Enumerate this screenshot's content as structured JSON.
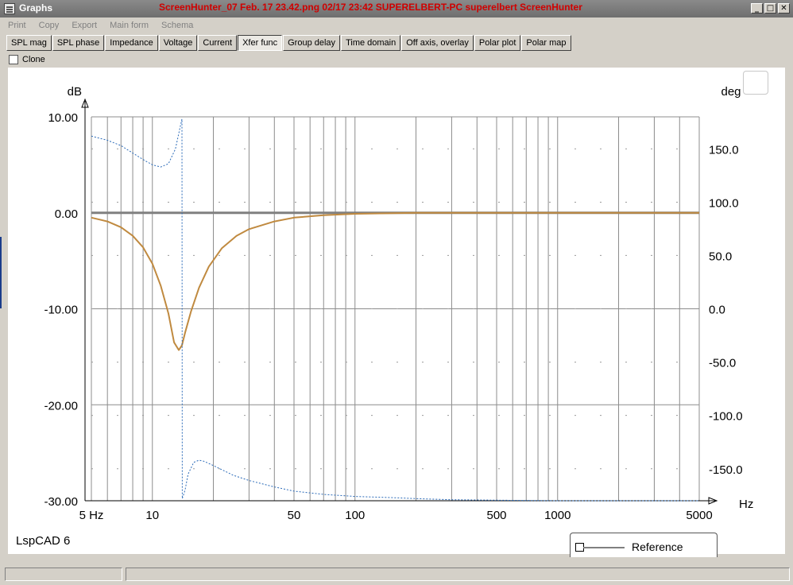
{
  "window": {
    "title": "Graphs",
    "caption": "ScreenHunter_07 Feb. 17 23.42.png  02/17  23:42  SUPERELBERT-PC  superelbert  ScreenHunter"
  },
  "window_buttons": [
    "_",
    "□",
    "✕"
  ],
  "menu": [
    "Print",
    "Copy",
    "Export",
    "Main form",
    "Schema"
  ],
  "tabs": [
    "SPL mag",
    "SPL phase",
    "Impedance",
    "Voltage",
    "Current",
    "Xfer func",
    "Group delay",
    "Time domain",
    "Off axis, overlay",
    "Polar plot",
    "Polar map"
  ],
  "active_tab": "Xfer func",
  "clone_label": "Clone",
  "app_label": "LspCAD 6",
  "legend": {
    "label": "Reference"
  },
  "colors": {
    "magnitude": "#c08a40",
    "phase": "#2a6ab8",
    "reference": "#808080",
    "caption": "#d00000"
  },
  "chart_data": {
    "type": "line",
    "xscale": "log",
    "xlim": [
      5,
      5000
    ],
    "xlabel": "Hz",
    "ylabel_left": "dB",
    "ylabel_right": "deg",
    "ylim_left": [
      -30,
      10
    ],
    "ylim_right": [
      -180,
      180
    ],
    "xticks": [
      {
        "value": 5,
        "label": "5 Hz"
      },
      {
        "value": 10,
        "label": "10"
      },
      {
        "value": 50,
        "label": "50"
      },
      {
        "value": 100,
        "label": "100"
      },
      {
        "value": 500,
        "label": "500"
      },
      {
        "value": 1000,
        "label": "1000"
      },
      {
        "value": 5000,
        "label": "5000"
      }
    ],
    "yticks_left": [
      {
        "value": 10,
        "label": "10.00"
      },
      {
        "value": 0,
        "label": "0.00"
      },
      {
        "value": -10,
        "label": "-10.00"
      },
      {
        "value": -20,
        "label": "-20.00"
      },
      {
        "value": -30,
        "label": "-30.00"
      }
    ],
    "yticks_right": [
      {
        "value": 150,
        "label": "150.0"
      },
      {
        "value": 100,
        "label": "100.0"
      },
      {
        "value": 50,
        "label": "50.0"
      },
      {
        "value": 0,
        "label": "0.0"
      },
      {
        "value": -50,
        "label": "-50.0"
      },
      {
        "value": -100,
        "label": "-100.0"
      },
      {
        "value": -150,
        "label": "-150.0"
      }
    ],
    "grid": true,
    "series": [
      {
        "key": "reference",
        "axis": "left",
        "x": [
          5,
          5000
        ],
        "y": [
          0,
          0
        ]
      },
      {
        "key": "magnitude",
        "axis": "left",
        "x": [
          5,
          6,
          7,
          8,
          9,
          10,
          11,
          12,
          12.8,
          13.5,
          14,
          14.5,
          15.5,
          17,
          19,
          22,
          26,
          30,
          40,
          50,
          70,
          100,
          200,
          5000
        ],
        "y": [
          -0.5,
          -0.9,
          -1.5,
          -2.4,
          -3.6,
          -5.3,
          -7.6,
          -10.5,
          -13.5,
          -14.3,
          -13.8,
          -12.5,
          -10.3,
          -7.8,
          -5.6,
          -3.7,
          -2.4,
          -1.7,
          -0.9,
          -0.5,
          -0.25,
          -0.1,
          0,
          0
        ]
      },
      {
        "key": "phase",
        "axis": "right",
        "x": [
          5,
          6,
          7,
          8,
          9,
          10,
          11,
          12,
          13,
          13.7,
          14,
          14.05,
          14.5,
          15,
          16,
          17,
          18,
          20,
          25,
          30,
          40,
          50,
          70,
          100,
          150,
          200,
          300,
          500,
          1000,
          2000,
          5000
        ],
        "y": [
          162,
          158,
          153,
          146,
          140,
          135,
          133,
          136,
          150,
          170,
          178,
          -178,
          -170,
          -155,
          -144,
          -142,
          -143,
          -147,
          -156,
          -161,
          -167,
          -171,
          -174,
          -176,
          -177,
          -178,
          -179,
          -179.5,
          -180,
          -180,
          -180
        ]
      }
    ]
  }
}
